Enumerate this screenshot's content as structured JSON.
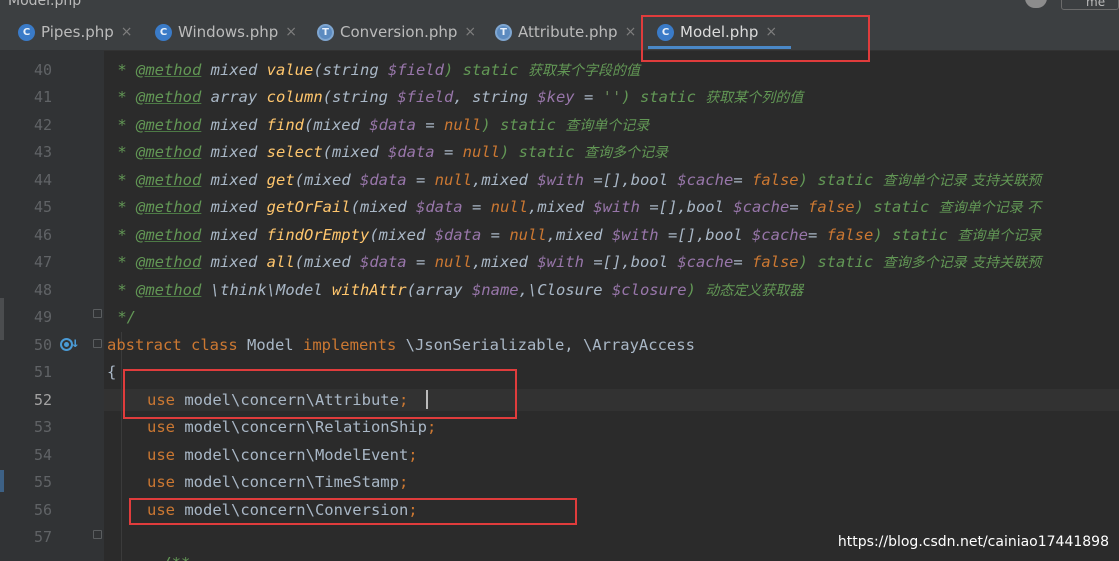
{
  "window": {
    "title": "Model.php",
    "right_box_text": "me"
  },
  "tabs": [
    {
      "label": "Pipes.php",
      "icon": "php-class-icon",
      "icon_glyph": "C",
      "active": false
    },
    {
      "label": "Windows.php",
      "icon": "php-class-icon",
      "icon_glyph": "C",
      "active": false
    },
    {
      "label": "Conversion.php",
      "icon": "php-trait-icon",
      "icon_glyph": "T",
      "active": false
    },
    {
      "label": "Attribute.php",
      "icon": "php-trait-icon",
      "icon_glyph": "T",
      "active": false
    },
    {
      "label": "Model.php",
      "icon": "php-class-icon",
      "icon_glyph": "C",
      "active": true
    }
  ],
  "tab_close_glyph": "×",
  "gutter": {
    "line_numbers": [
      "40",
      "41",
      "42",
      "43",
      "44",
      "45",
      "46",
      "47",
      "48",
      "49",
      "50",
      "51",
      "52",
      "53",
      "54",
      "55",
      "56",
      "57"
    ],
    "current_line": "52",
    "override_icon": "implements-override-icon"
  },
  "code": {
    "l40": {
      "p1": " * ",
      "tag": "@method",
      "p2": " mixed ",
      "fn": "value",
      "p3": "(string ",
      "v1": "$field",
      "p4": ") static ",
      "cn": "获取某个字段的值"
    },
    "l41": {
      "p1": " * ",
      "tag": "@method",
      "p2": " array ",
      "fn": "column",
      "p3": "(string ",
      "v1": "$field",
      "p4": ", string ",
      "v2": "$key",
      "p5": " = ",
      "s1": "''",
      "p6": ") static ",
      "cn": "获取某个列的值"
    },
    "l42": {
      "p1": " * ",
      "tag": "@method",
      "p2": " mixed ",
      "fn": "find",
      "p3": "(mixed ",
      "v1": "$data",
      "p4": " = ",
      "k1": "null",
      "p5": ") static ",
      "cn": "查询单个记录"
    },
    "l43": {
      "p1": " * ",
      "tag": "@method",
      "p2": " mixed ",
      "fn": "select",
      "p3": "(mixed ",
      "v1": "$data",
      "p4": " = ",
      "k1": "null",
      "p5": ") static ",
      "cn": "查询多个记录"
    },
    "l44": {
      "p1": " * ",
      "tag": "@method",
      "p2": " mixed ",
      "fn": "get",
      "p3": "(mixed ",
      "v1": "$data",
      "p4": " = ",
      "k1": "null",
      "p5": ",mixed ",
      "v2": "$with",
      "p6": " =[],bool ",
      "v3": "$cache",
      "p7": "= ",
      "k2": "false",
      "p8": ") static ",
      "cn": "查询单个记录 支持关联预"
    },
    "l45": {
      "p1": " * ",
      "tag": "@method",
      "p2": " mixed ",
      "fn": "getOrFail",
      "p3": "(mixed ",
      "v1": "$data",
      "p4": " = ",
      "k1": "null",
      "p5": ",mixed ",
      "v2": "$with",
      "p6": " =[],bool ",
      "v3": "$cache",
      "p7": "= ",
      "k2": "false",
      "p8": ") static ",
      "cn": "查询单个记录 不"
    },
    "l46": {
      "p1": " * ",
      "tag": "@method",
      "p2": " mixed ",
      "fn": "findOrEmpty",
      "p3": "(mixed ",
      "v1": "$data",
      "p4": " = ",
      "k1": "null",
      "p5": ",mixed ",
      "v2": "$with",
      "p6": " =[],bool ",
      "v3": "$cache",
      "p7": "= ",
      "k2": "false",
      "p8": ") static ",
      "cn": "查询单个记录"
    },
    "l47": {
      "p1": " * ",
      "tag": "@method",
      "p2": " mixed ",
      "fn": "all",
      "p3": "(mixed ",
      "v1": "$data",
      "p4": " = ",
      "k1": "null",
      "p5": ",mixed ",
      "v2": "$with",
      "p6": " =[],bool ",
      "v3": "$cache",
      "p7": "= ",
      "k2": "false",
      "p8": ") static ",
      "cn": "查询多个记录 支持关联预"
    },
    "l48": {
      "p1": " * ",
      "tag": "@method",
      "p2": " \\think\\Model ",
      "fn": "withAttr",
      "p3": "(array ",
      "v1": "$name",
      "p4": ",\\Closure ",
      "v2": "$closure",
      "p5": ") ",
      "cn": "动态定义获取器"
    },
    "l49": {
      "text": " */"
    },
    "l50": {
      "kw1": "abstract class ",
      "name": "Model ",
      "kw2": "implements ",
      "rest": "\\JsonSerializable, \\ArrayAccess"
    },
    "l51": {
      "text": "{"
    },
    "l52": {
      "kw": "use ",
      "path": "model\\concern\\Attribute",
      "semi": ";"
    },
    "l53": {
      "kw": "use ",
      "path": "model\\concern\\RelationShip",
      "semi": ";"
    },
    "l54": {
      "kw": "use ",
      "path": "model\\concern\\ModelEvent",
      "semi": ";"
    },
    "l55": {
      "kw": "use ",
      "path": "model\\concern\\TimeStamp",
      "semi": ";"
    },
    "l56": {
      "kw": "use ",
      "path": "model\\concern\\Conversion",
      "semi": ";"
    },
    "l57": {
      "text": ""
    },
    "l58": {
      "text": "    /**"
    }
  },
  "colors": {
    "background": "#2b2b2b",
    "doc_comment": "#629755",
    "keyword": "#cc7832",
    "function": "#ffc66d",
    "variable": "#9876aa",
    "annotation_box": "#e03c3c",
    "active_tab_underline": "#4a88c7"
  },
  "watermark": "https://blog.csdn.net/cainiao17441898"
}
